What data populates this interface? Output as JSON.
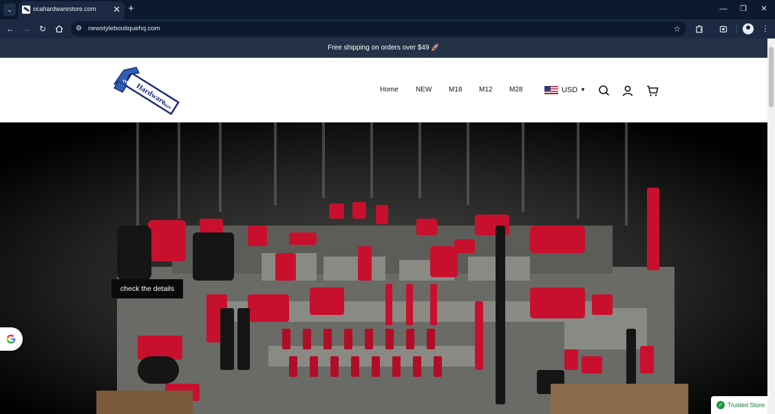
{
  "browser": {
    "tab_title": "ocahardwarestore.com",
    "tab_close": "✕",
    "new_tab": "+",
    "url": "newstyleboutiquehq.com",
    "window_controls": {
      "minimize": "—",
      "restore": "❐",
      "close": "✕"
    },
    "icons": [
      "tab-search-icon",
      "back-arrow-icon",
      "forward-arrow-icon",
      "reload-icon",
      "home-icon",
      "site-info-icon",
      "bookmark-star-icon",
      "extensions-puzzle-icon",
      "screenshot-icon",
      "profile-icon",
      "kebab-menu-icon"
    ]
  },
  "announcement": {
    "text": "Free shipping on orders over $49 🚀"
  },
  "header": {
    "logo_alt": "The Hardware Store",
    "logo_text": {
      "the": "The",
      "hardware": "Hardware",
      "store": "store"
    },
    "menu": [
      {
        "label": "Home"
      },
      {
        "label": "NEW"
      },
      {
        "label": "M18"
      },
      {
        "label": "M12"
      },
      {
        "label": "M28"
      }
    ],
    "currency": {
      "code": "USD",
      "flag": "us-flag-icon"
    },
    "icons": [
      "search-icon",
      "account-icon",
      "cart-icon"
    ]
  },
  "hero": {
    "cta_label": "check the details"
  },
  "widgets": {
    "trusted_store": "Trusted Store"
  },
  "colors": {
    "browser_dark": "#0b1a2f",
    "toolbar": "#1b2a42",
    "announcement_bar": "#243247",
    "tool_red": "#c8102e",
    "trusted_green": "#1a9c3e"
  }
}
